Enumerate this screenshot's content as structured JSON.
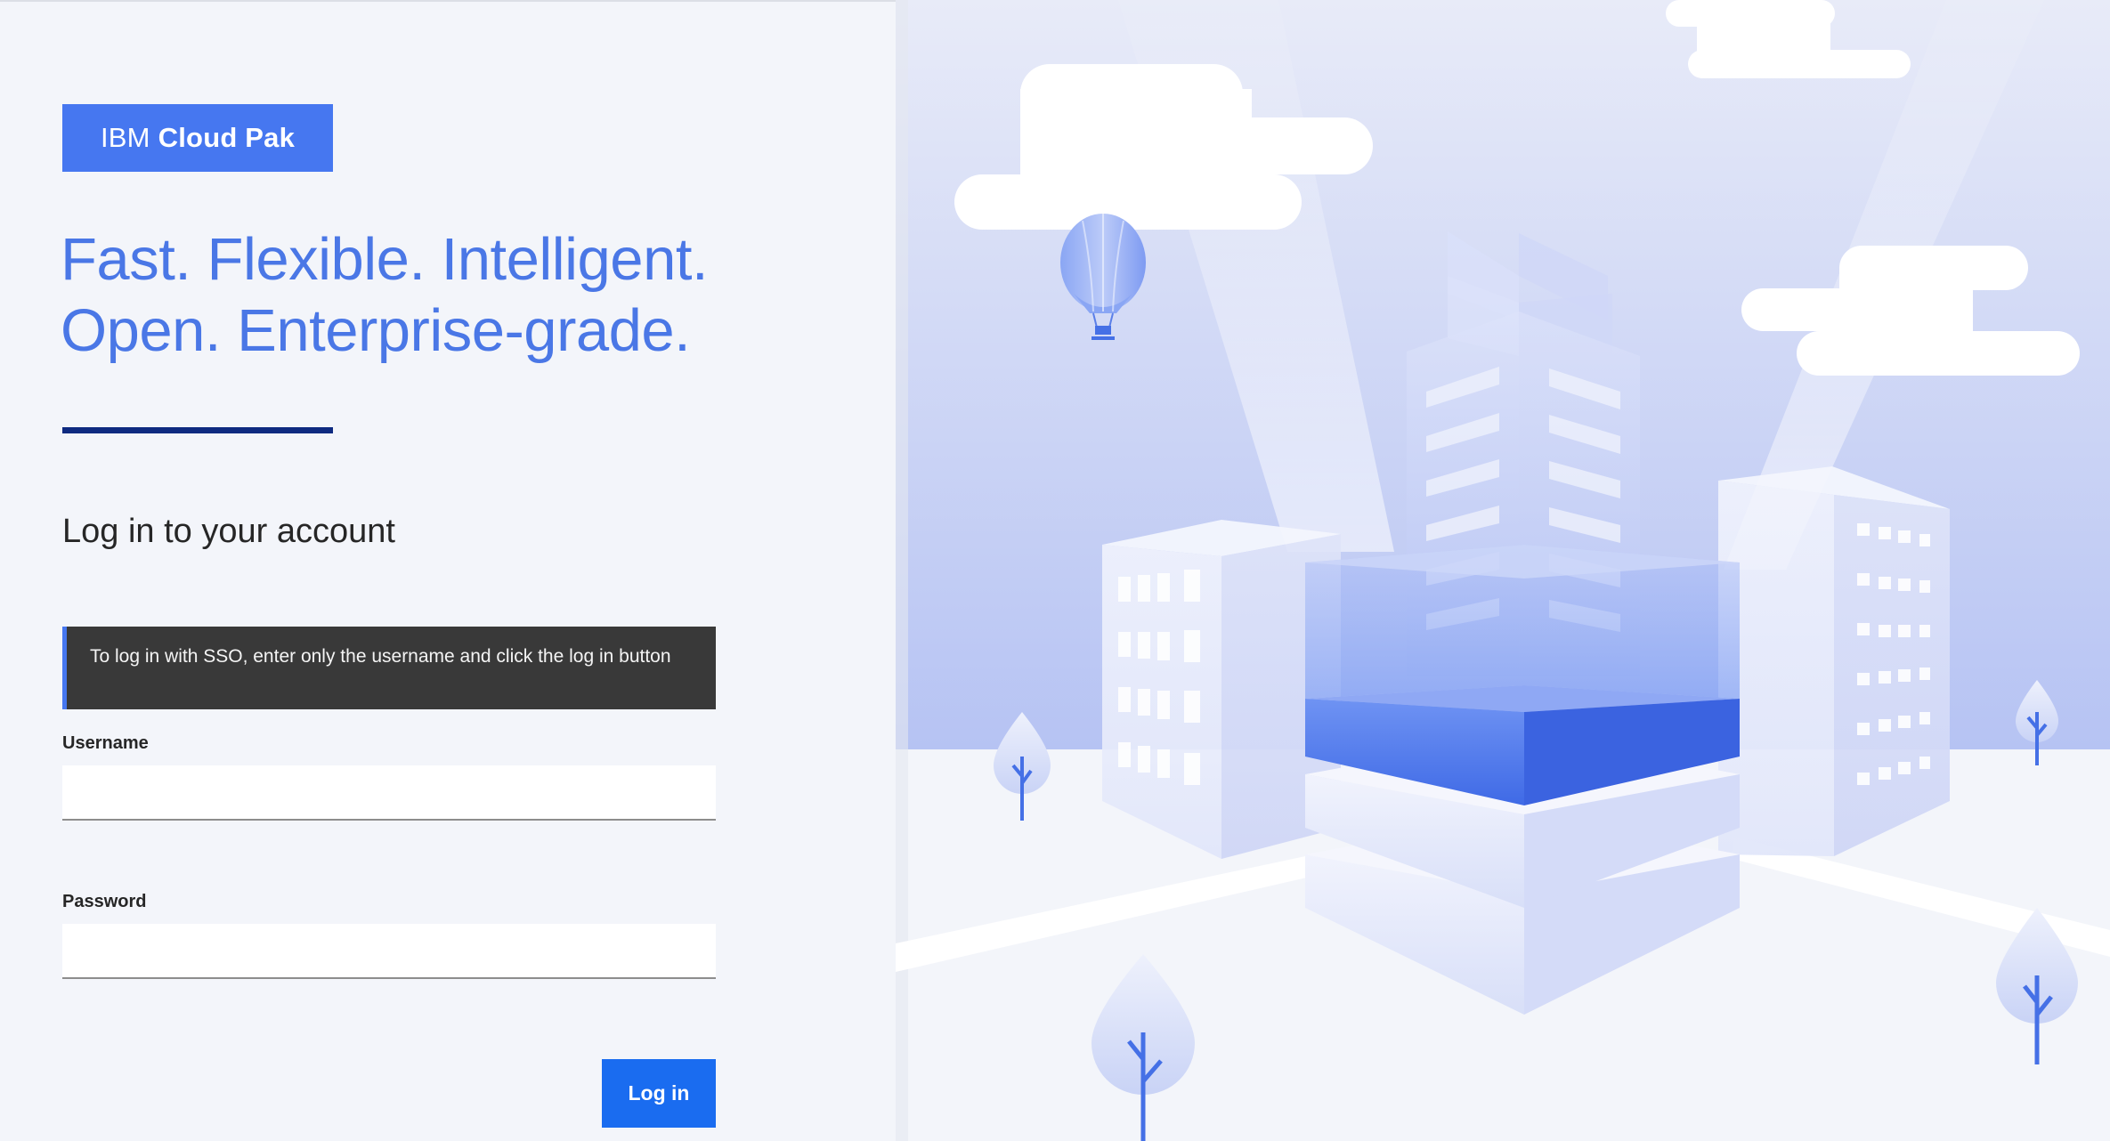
{
  "brand": {
    "light": "IBM",
    "bold": "Cloud Pak"
  },
  "tagline": {
    "line1": "Fast. Flexible. Intelligent.",
    "line2": "Open. Enterprise-grade."
  },
  "login": {
    "heading": "Log in to your account",
    "notice": "To log in with SSO, enter only the username and click the log in button",
    "username_label": "Username",
    "username_value": "",
    "password_label": "Password",
    "password_value": "",
    "submit_label": "Log in"
  },
  "illustration": {
    "icons": [
      "cloud-icon",
      "hot-air-balloon-icon",
      "building-icon",
      "tree-icon"
    ]
  },
  "colors": {
    "brand": "#4677f0",
    "accent": "#1a6cf0",
    "tagline": "#4a77e6",
    "divider": "#0e2a80",
    "notice_bg": "#393939",
    "sky": "#c3cdf6",
    "ground": "#f3f5fa"
  }
}
